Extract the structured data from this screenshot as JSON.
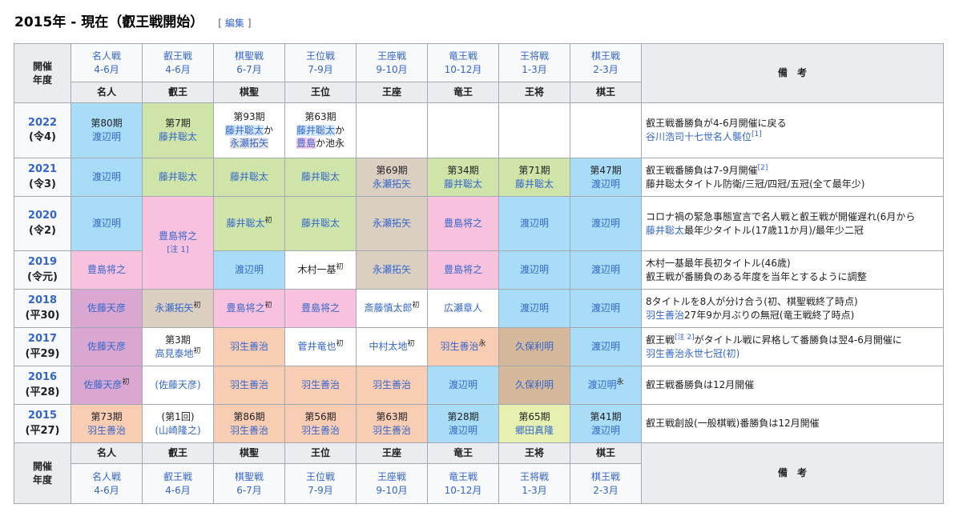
{
  "heading": {
    "title": "2015年 - 現在（叡王戦開始）",
    "bracket_open": "[",
    "edit": "編集",
    "bracket_close": "]"
  },
  "colors": {
    "blue": "#a9dcf7",
    "green": "#cfe4a8",
    "pink": "#f8c1de",
    "tan": "#dbcfc2",
    "purple": "#d9a7d2",
    "peach": "#f9cdb4",
    "brown": "#d5b79b",
    "yellow": "#e7f0b0",
    "white": "#ffffff",
    "header": "#eaecf0"
  },
  "header": {
    "held_label_1": "開催",
    "held_label_2": "年度",
    "remarks": "備　考",
    "events": [
      {
        "name": "名人戦",
        "months": "4-6月",
        "title": "名人"
      },
      {
        "name": "叡王戦",
        "months": "4-6月",
        "title": "叡王"
      },
      {
        "name": "棋聖戦",
        "months": "6-7月",
        "title": "棋聖"
      },
      {
        "name": "王位戦",
        "months": "7-9月",
        "title": "王位"
      },
      {
        "name": "王座戦",
        "months": "9-10月",
        "title": "王座"
      },
      {
        "name": "竜王戦",
        "months": "10-12月",
        "title": "竜王"
      },
      {
        "name": "王将戦",
        "months": "1-3月",
        "title": "王将"
      },
      {
        "name": "棋王戦",
        "months": "2-3月",
        "title": "棋王"
      }
    ]
  },
  "rows": [
    {
      "year": "2022",
      "era": "(令4)",
      "cells": [
        {
          "color": "blue",
          "lines": [
            {
              "text": "第80期",
              "style": "plain"
            },
            {
              "text": "渡辺明",
              "style": "link"
            }
          ]
        },
        {
          "color": "green",
          "lines": [
            {
              "text": "第7期",
              "style": "plain"
            },
            {
              "text": "藤井聡太",
              "style": "link"
            }
          ]
        },
        {
          "color": "white",
          "lines": [
            {
              "text": "第93期",
              "style": "plain"
            },
            {
              "parts": [
                {
                  "text": "藤井聡太",
                  "style": "link",
                  "hl": "blue"
                },
                {
                  "text": "か",
                  "style": "plain"
                }
              ]
            },
            {
              "parts": [
                {
                  "text": "永瀬拓矢",
                  "style": "link",
                  "hl": "grey"
                }
              ]
            }
          ]
        },
        {
          "color": "white",
          "lines": [
            {
              "text": "第63期",
              "style": "plain"
            },
            {
              "parts": [
                {
                  "text": "藤井聡太",
                  "style": "link",
                  "hl": "blue"
                },
                {
                  "text": "か",
                  "style": "plain"
                }
              ]
            },
            {
              "parts": [
                {
                  "text": "豊島",
                  "style": "link",
                  "hl": "pink"
                },
                {
                  "text": "か池永",
                  "style": "plain"
                }
              ]
            }
          ]
        },
        {
          "color": "white",
          "lines": []
        },
        {
          "color": "white",
          "lines": []
        },
        {
          "color": "white",
          "lines": []
        },
        {
          "color": "white",
          "lines": []
        }
      ],
      "notes": [
        {
          "text": "叡王戦番勝負が4-6月開催に戻る"
        },
        {
          "text": "谷川浩司十七世名人襲位",
          "style": "link",
          "sup": "[1]"
        }
      ]
    },
    {
      "year": "2021",
      "era": "(令3)",
      "cells": [
        {
          "color": "blue",
          "lines": [
            {
              "text": "渡辺明",
              "style": "link"
            }
          ]
        },
        {
          "color": "green",
          "lines": [
            {
              "text": "藤井聡太",
              "style": "link"
            }
          ]
        },
        {
          "color": "green",
          "lines": [
            {
              "text": "藤井聡太",
              "style": "link"
            }
          ]
        },
        {
          "color": "green",
          "lines": [
            {
              "text": "藤井聡太",
              "style": "link"
            }
          ]
        },
        {
          "color": "tan",
          "lines": [
            {
              "text": "第69期",
              "style": "plain"
            },
            {
              "text": "永瀬拓矢",
              "style": "link"
            }
          ]
        },
        {
          "color": "green",
          "lines": [
            {
              "text": "第34期",
              "style": "plain"
            },
            {
              "text": "藤井聡太",
              "style": "link"
            }
          ]
        },
        {
          "color": "green",
          "lines": [
            {
              "text": "第71期",
              "style": "plain"
            },
            {
              "text": "藤井聡太",
              "style": "link"
            }
          ]
        },
        {
          "color": "blue",
          "lines": [
            {
              "text": "第47期",
              "style": "plain"
            },
            {
              "text": "渡辺明",
              "style": "link"
            }
          ]
        }
      ],
      "notes": [
        {
          "text": "叡王戦番勝負は7-9月開催",
          "sup": "[2]"
        },
        {
          "text": "藤井聡太タイトル防衛/三冠/四冠/五冠(全て最年少)"
        }
      ]
    },
    {
      "year": "2020",
      "era": "(令2)",
      "cells": [
        {
          "color": "blue",
          "lines": [
            {
              "text": "渡辺明",
              "style": "link"
            }
          ]
        },
        {
          "color": "pink",
          "rowspan": 2,
          "lines": [
            {
              "text": "豊島将之",
              "style": "link"
            },
            {
              "text": "[注 1]",
              "style": "link",
              "small": true
            }
          ]
        },
        {
          "color": "green",
          "lines": [
            {
              "text": "藤井聡太",
              "style": "link",
              "sup": "初"
            }
          ]
        },
        {
          "color": "green",
          "lines": [
            {
              "text": "藤井聡太",
              "style": "link"
            }
          ]
        },
        {
          "color": "tan",
          "lines": [
            {
              "text": "永瀬拓矢",
              "style": "link"
            }
          ]
        },
        {
          "color": "pink",
          "lines": [
            {
              "text": "豊島将之",
              "style": "link"
            }
          ]
        },
        {
          "color": "blue",
          "lines": [
            {
              "text": "渡辺明",
              "style": "link"
            }
          ]
        },
        {
          "color": "blue",
          "lines": [
            {
              "text": "渡辺明",
              "style": "link"
            }
          ]
        }
      ],
      "notes": [
        {
          "text": "コロナ禍の緊急事態宣言で名人戦と叡王戦が開催遅れ(6月から"
        },
        {
          "text": "藤井聡太",
          "style": "link",
          "tail": "最年少タイトル(17歳11か月)/最年少二冠"
        }
      ]
    },
    {
      "year": "2019",
      "era": "(令元)",
      "cells": [
        {
          "color": "pink",
          "lines": [
            {
              "text": "豊島将之",
              "style": "link"
            }
          ]
        },
        {
          "color": "blue",
          "lines": [
            {
              "text": "渡辺明",
              "style": "link"
            }
          ]
        },
        {
          "color": "white",
          "lines": [
            {
              "text": "木村一基",
              "style": "plain",
              "sup": "初"
            }
          ]
        },
        {
          "color": "tan",
          "lines": [
            {
              "text": "永瀬拓矢",
              "style": "link"
            }
          ]
        },
        {
          "color": "pink",
          "lines": [
            {
              "text": "豊島将之",
              "style": "link"
            }
          ]
        },
        {
          "color": "blue",
          "lines": [
            {
              "text": "渡辺明",
              "style": "link"
            }
          ]
        },
        {
          "color": "blue",
          "lines": [
            {
              "text": "渡辺明",
              "style": "link"
            }
          ]
        }
      ],
      "notes": [
        {
          "text": "木村一基最年長初タイトル(46歳)"
        },
        {
          "text": "叡王戦が番勝負のある年度を当年とするように調整"
        }
      ]
    },
    {
      "year": "2018",
      "era": "(平30)",
      "cells": [
        {
          "color": "purple",
          "lines": [
            {
              "text": "佐藤天彦",
              "style": "link"
            }
          ]
        },
        {
          "color": "tan",
          "lines": [
            {
              "text": "永瀬拓矢",
              "style": "link",
              "sup": "初"
            }
          ]
        },
        {
          "color": "pink",
          "lines": [
            {
              "text": "豊島将之",
              "style": "link",
              "sup": "初"
            }
          ]
        },
        {
          "color": "pink",
          "lines": [
            {
              "text": "豊島将之",
              "style": "link"
            }
          ]
        },
        {
          "color": "white",
          "lines": [
            {
              "text": "斎藤慎太郎",
              "style": "link",
              "sup": "初"
            }
          ]
        },
        {
          "color": "white",
          "lines": [
            {
              "text": "広瀬章人",
              "style": "link"
            }
          ]
        },
        {
          "color": "blue",
          "lines": [
            {
              "text": "渡辺明",
              "style": "link"
            }
          ]
        },
        {
          "color": "blue",
          "lines": [
            {
              "text": "渡辺明",
              "style": "link"
            }
          ]
        }
      ],
      "notes": [
        {
          "text": "8タイトルを8人が分け合う(初、棋聖戦終了時点)"
        },
        {
          "text": "羽生善治",
          "style": "link",
          "tail": "27年9か月ぶりの無冠(竜王戦終了時点)"
        }
      ]
    },
    {
      "year": "2017",
      "era": "(平29)",
      "cells": [
        {
          "color": "purple",
          "lines": [
            {
              "text": "佐藤天彦",
              "style": "link"
            }
          ]
        },
        {
          "color": "white",
          "lines": [
            {
              "text": "第3期",
              "style": "plain"
            },
            {
              "text": "高見泰地",
              "style": "link",
              "sup": "初"
            }
          ]
        },
        {
          "color": "peach",
          "lines": [
            {
              "text": "羽生善治",
              "style": "link"
            }
          ]
        },
        {
          "color": "white",
          "lines": [
            {
              "text": "菅井竜也",
              "style": "link",
              "sup": "初"
            }
          ]
        },
        {
          "color": "white",
          "lines": [
            {
              "text": "中村太地",
              "style": "link",
              "sup": "初"
            }
          ]
        },
        {
          "color": "peach",
          "lines": [
            {
              "text": "羽生善治",
              "style": "link",
              "sup": "永"
            }
          ]
        },
        {
          "color": "brown",
          "lines": [
            {
              "text": "久保利明",
              "style": "link"
            }
          ]
        },
        {
          "color": "blue",
          "lines": [
            {
              "text": "渡辺明",
              "style": "link"
            }
          ]
        }
      ],
      "notes": [
        {
          "text": "叡王戦",
          "sup": "[注 2]",
          "tail": "がタイトル戦に昇格して番勝負は翌4-6月開催に"
        },
        {
          "text": "羽生善治永世七冠(初)",
          "style": "link"
        }
      ]
    },
    {
      "year": "2016",
      "era": "(平28)",
      "cells": [
        {
          "color": "purple",
          "lines": [
            {
              "text": "佐藤天彦",
              "style": "link",
              "sup": "初"
            }
          ]
        },
        {
          "color": "white",
          "lines": [
            {
              "parts": [
                {
                  "text": "(佐藤天彦)",
                  "style": "link",
                  "hl": "purple"
                }
              ]
            }
          ]
        },
        {
          "color": "peach",
          "lines": [
            {
              "text": "羽生善治",
              "style": "link"
            }
          ]
        },
        {
          "color": "peach",
          "lines": [
            {
              "text": "羽生善治",
              "style": "link"
            }
          ]
        },
        {
          "color": "peach",
          "lines": [
            {
              "text": "羽生善治",
              "style": "link"
            }
          ]
        },
        {
          "color": "blue",
          "lines": [
            {
              "text": "渡辺明",
              "style": "link"
            }
          ]
        },
        {
          "color": "brown",
          "lines": [
            {
              "text": "久保利明",
              "style": "link"
            }
          ]
        },
        {
          "color": "blue",
          "lines": [
            {
              "text": "渡辺明",
              "style": "link",
              "sup": "永"
            }
          ]
        }
      ],
      "notes": [
        {
          "text": "叡王戦番勝負は12月開催"
        }
      ]
    },
    {
      "year": "2015",
      "era": "(平27)",
      "cells": [
        {
          "color": "peach",
          "lines": [
            {
              "text": "第73期",
              "style": "plain"
            },
            {
              "text": "羽生善治",
              "style": "link"
            }
          ]
        },
        {
          "color": "white",
          "lines": [
            {
              "text": "(第1回)",
              "style": "plain"
            },
            {
              "text": "(山崎隆之)",
              "style": "link"
            }
          ]
        },
        {
          "color": "peach",
          "lines": [
            {
              "text": "第86期",
              "style": "plain"
            },
            {
              "text": "羽生善治",
              "style": "link"
            }
          ]
        },
        {
          "color": "peach",
          "lines": [
            {
              "text": "第56期",
              "style": "plain"
            },
            {
              "text": "羽生善治",
              "style": "link"
            }
          ]
        },
        {
          "color": "peach",
          "lines": [
            {
              "text": "第63期",
              "style": "plain"
            },
            {
              "text": "羽生善治",
              "style": "link"
            }
          ]
        },
        {
          "color": "blue",
          "lines": [
            {
              "text": "第28期",
              "style": "plain"
            },
            {
              "text": "渡辺明",
              "style": "link"
            }
          ]
        },
        {
          "color": "yellow",
          "lines": [
            {
              "text": "第65期",
              "style": "plain"
            },
            {
              "text": "郷田真隆",
              "style": "link"
            }
          ]
        },
        {
          "color": "blue",
          "lines": [
            {
              "text": "第41期",
              "style": "plain"
            },
            {
              "text": "渡辺明",
              "style": "link"
            }
          ]
        }
      ],
      "notes": [
        {
          "text": "叡王戦創設(一般棋戦)番勝負は12月開催"
        }
      ]
    }
  ]
}
